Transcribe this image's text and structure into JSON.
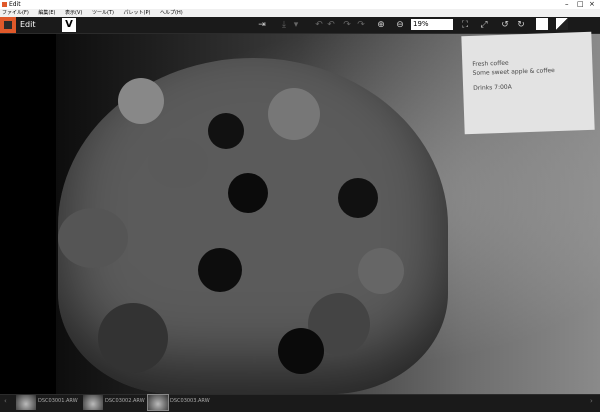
{
  "window": {
    "title": "Edit"
  },
  "menu": {
    "items": [
      "ファイル(F)",
      "編集(E)",
      "表示(V)",
      "ツール(T)",
      "パレット(P)",
      "ヘルプ(H)"
    ]
  },
  "toolbar": {
    "mode_label": "Edit",
    "brand_mark": "V",
    "zoom_value": "19%"
  },
  "photo": {
    "note_lines": [
      "Fresh coffee",
      "Some sweet apple & coffee",
      "Drinks 7:00A"
    ]
  },
  "filmstrip": {
    "items": [
      {
        "name": "DSC03001.ARW"
      },
      {
        "name": "DSC03002.ARW"
      },
      {
        "name": "DSC03003.ARW"
      }
    ]
  }
}
